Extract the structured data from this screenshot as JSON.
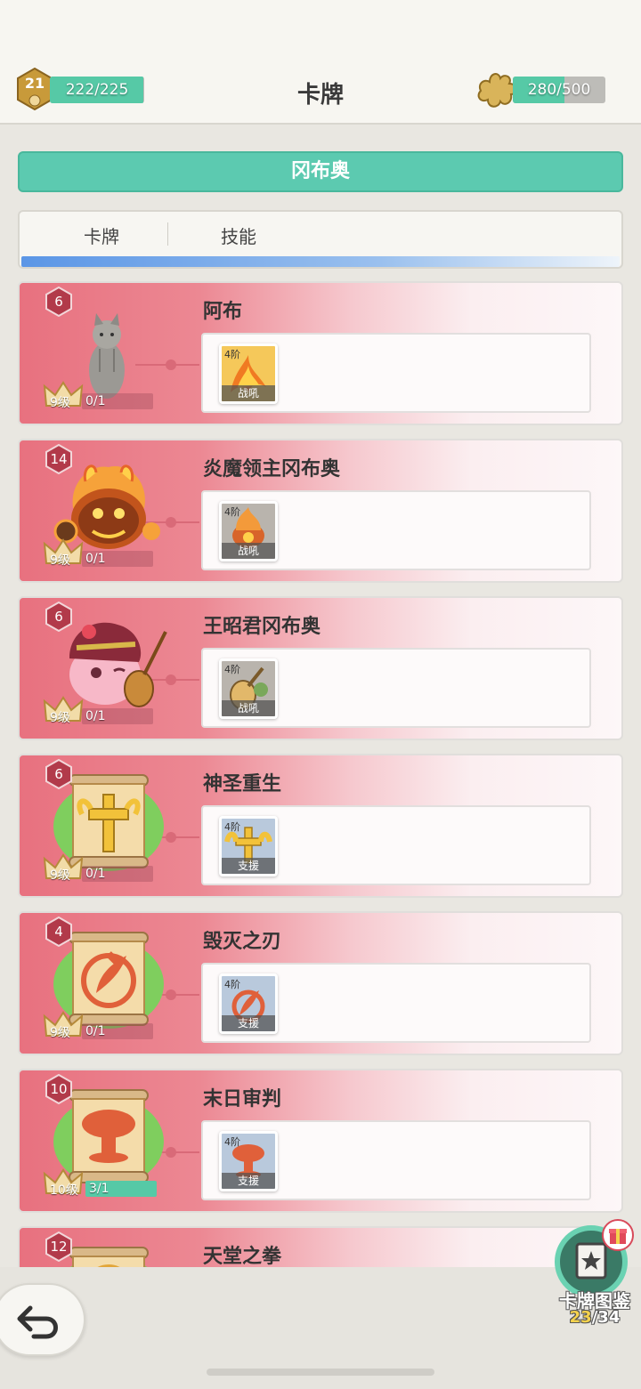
{
  "header": {
    "title": "卡牌",
    "player_level": "21",
    "xp": "222/225",
    "xp_fraction": 0.9867,
    "pieces": "280/500",
    "pieces_fraction": 0.56
  },
  "hero": {
    "name": "冈布奥"
  },
  "tabs": [
    {
      "label": "卡牌"
    },
    {
      "label": "技能"
    }
  ],
  "cards": [
    {
      "name": "阿布",
      "level": "6",
      "star_level": "9级",
      "progress": "0/1",
      "progress_fraction": 0,
      "skill_tier": "4阶",
      "skill_type": "战吼",
      "art": "cat"
    },
    {
      "name": "炎魔领主冈布奥",
      "level": "14",
      "star_level": "9级",
      "progress": "0/1",
      "progress_fraction": 0,
      "skill_tier": "4阶",
      "skill_type": "战吼",
      "art": "fire-demon"
    },
    {
      "name": "王昭君冈布奥",
      "level": "6",
      "star_level": "9级",
      "progress": "0/1",
      "progress_fraction": 0,
      "skill_tier": "4阶",
      "skill_type": "战吼",
      "art": "wang-zhaojun"
    },
    {
      "name": "神圣重生",
      "level": "6",
      "star_level": "9级",
      "progress": "0/1",
      "progress_fraction": 0,
      "skill_tier": "4阶",
      "skill_type": "支援",
      "art": "holy-cross-scroll"
    },
    {
      "name": "毁灭之刃",
      "level": "4",
      "star_level": "9级",
      "progress": "0/1",
      "progress_fraction": 0,
      "skill_tier": "4阶",
      "skill_type": "支援",
      "art": "blade-scroll"
    },
    {
      "name": "末日审判",
      "level": "10",
      "star_level": "10级",
      "progress": "3/1",
      "progress_fraction": 1,
      "skill_tier": "4阶",
      "skill_type": "支援",
      "art": "mushroom-cloud-scroll"
    },
    {
      "name": "天堂之拳",
      "level": "12",
      "star_level": "",
      "progress": "",
      "progress_fraction": 0,
      "skill_tier": "",
      "skill_type": "",
      "art": "fist-scroll"
    }
  ],
  "collection": {
    "label": "卡牌图鉴",
    "current": "23",
    "total": "/34"
  },
  "colors": {
    "accent_teal": "#5ccab0",
    "card_pink": "#e8717f",
    "tab_blue": "#5b96e6"
  }
}
